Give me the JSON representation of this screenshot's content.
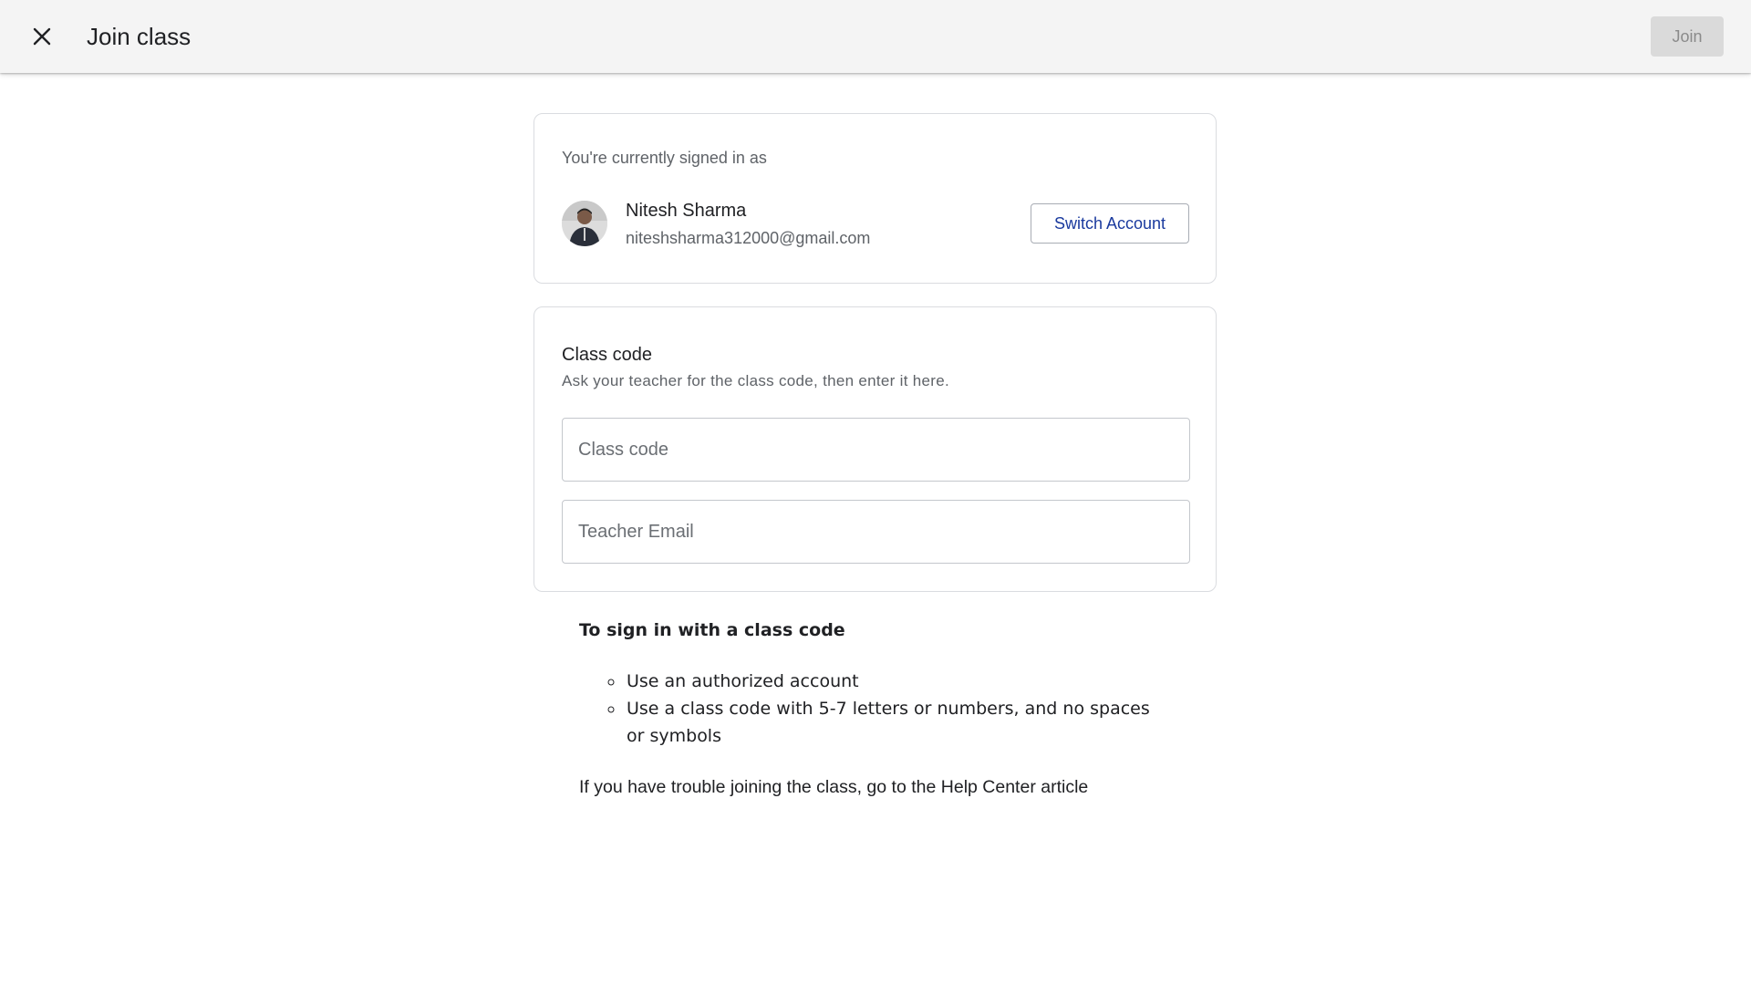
{
  "header": {
    "title": "Join class",
    "join_label": "Join"
  },
  "account": {
    "signed_in_label": "You're currently signed in as",
    "name": "Nitesh Sharma",
    "email": "niteshsharma312000@gmail.com",
    "switch_label": "Switch Account"
  },
  "class_code": {
    "title": "Class code",
    "help": "Ask your teacher for the class code, then enter it here.",
    "code_placeholder": "Class code",
    "email_placeholder": "Teacher Email"
  },
  "instructions": {
    "title": "To sign in with a class code",
    "items": [
      "Use an authorized account",
      "Use a class code with 5-7 letters or numbers, and no spaces or symbols"
    ],
    "trouble_prefix": "If you have trouble joining the class, go to the ",
    "help_link": "Help Center article"
  },
  "icons": {
    "close": "close-icon",
    "avatar": "avatar"
  },
  "colors": {
    "topbar": "#f4f4f4",
    "join_disabled_bg": "#dadada",
    "switch_text": "#1a3a9e",
    "border": "#dadce0"
  }
}
